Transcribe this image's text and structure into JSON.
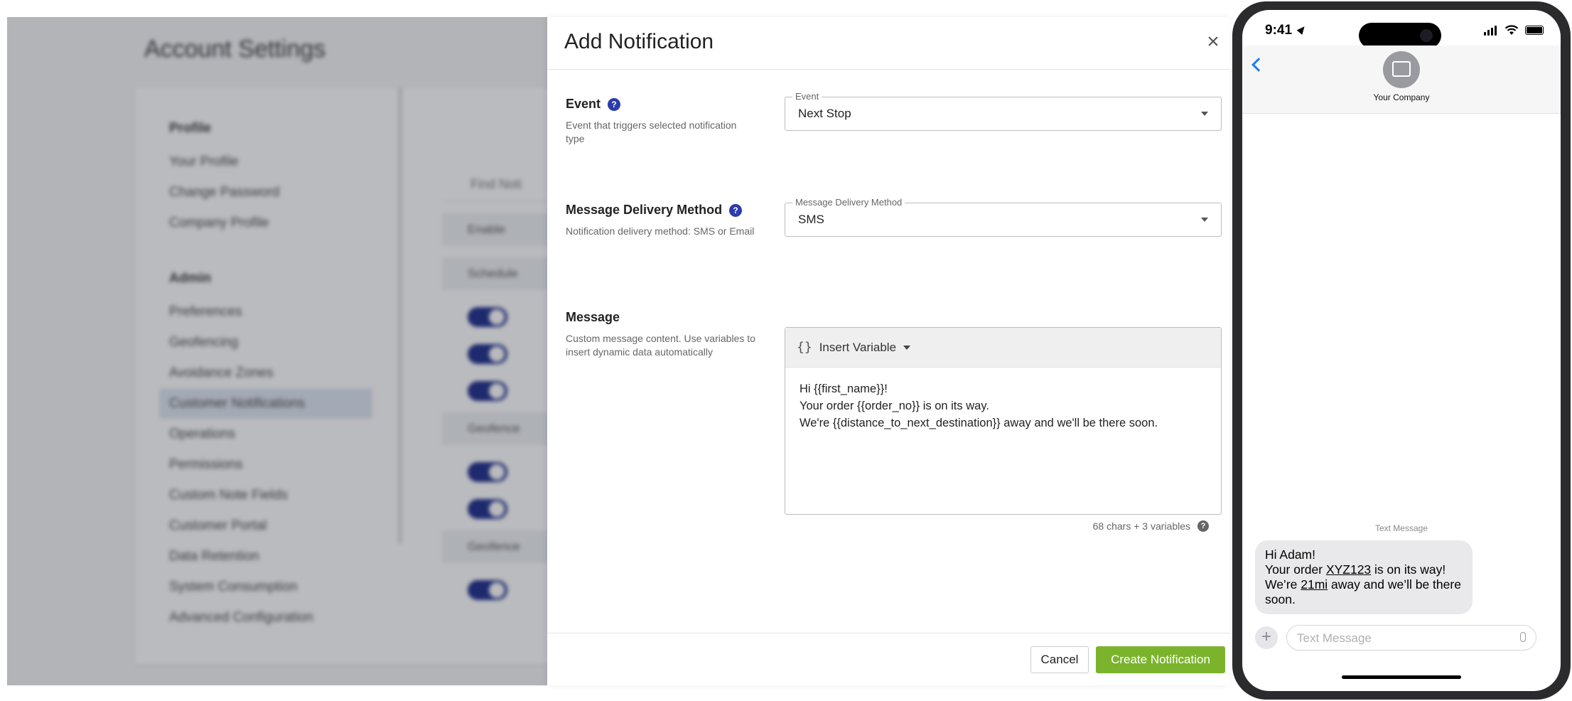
{
  "background": {
    "title": "Account Settings",
    "nav": [
      {
        "type": "group",
        "label": "Profile"
      },
      {
        "type": "item",
        "label": "Your Profile"
      },
      {
        "type": "item",
        "label": "Change Password"
      },
      {
        "type": "item",
        "label": "Company Profile"
      },
      {
        "type": "group",
        "label": "Admin"
      },
      {
        "type": "item",
        "label": "Preferences"
      },
      {
        "type": "item",
        "label": "Geofencing"
      },
      {
        "type": "item",
        "label": "Avoidance Zones"
      },
      {
        "type": "item",
        "label": "Customer Notifications",
        "active": true
      },
      {
        "type": "item",
        "label": "Operations"
      },
      {
        "type": "item",
        "label": "Permissions"
      },
      {
        "type": "item",
        "label": "Custom Note Fields"
      },
      {
        "type": "item",
        "label": "Customer Portal"
      },
      {
        "type": "item",
        "label": "Data Retention"
      },
      {
        "type": "item",
        "label": "System Consumption"
      },
      {
        "type": "item",
        "label": "Advanced Configuration"
      }
    ],
    "search_placeholder": "Find Noti",
    "table_header": "Enable",
    "group_rows": [
      "Schedule",
      "Geofence",
      "Geofence"
    ]
  },
  "dialog": {
    "title": "Add Notification",
    "close_glyph": "×",
    "event": {
      "label": "Event",
      "help_glyph": "?",
      "description": "Event that triggers selected notification type",
      "legend": "Event",
      "value": "Next Stop"
    },
    "delivery": {
      "label": "Message Delivery Method",
      "help_glyph": "?",
      "description": "Notification delivery method: SMS or Email",
      "legend": "Message Delivery Method",
      "value": "SMS"
    },
    "message": {
      "label": "Message",
      "description": "Custom message content. Use variables to insert dynamic data automatically",
      "toolbar_icon": "{}",
      "insert_label": "Insert Variable",
      "lines": [
        "Hi {{first_name}}!",
        "Your order {{order_no}} is on its way.",
        "We're {{distance_to_next_destination}} away and we'll be there soon."
      ],
      "counter": "68 chars + 3 variables",
      "counter_help_glyph": "?"
    },
    "cancel_label": "Cancel",
    "create_label": "Create Notification",
    "create_color": "#7bb42c"
  },
  "phone": {
    "time": "9:41",
    "contact_name": "Your Company",
    "message_meta": "Text Message",
    "bubble": {
      "line1": "Hi Adam!",
      "line2_pre": "Your order ",
      "order_no": "XYZ123",
      "line2_post": " is on its way!",
      "line3_pre": "We’re ",
      "distance": "21mi",
      "line3_post": " away and we’ll be there soon."
    },
    "compose_placeholder": "Text Message",
    "plus_glyph": "+"
  }
}
